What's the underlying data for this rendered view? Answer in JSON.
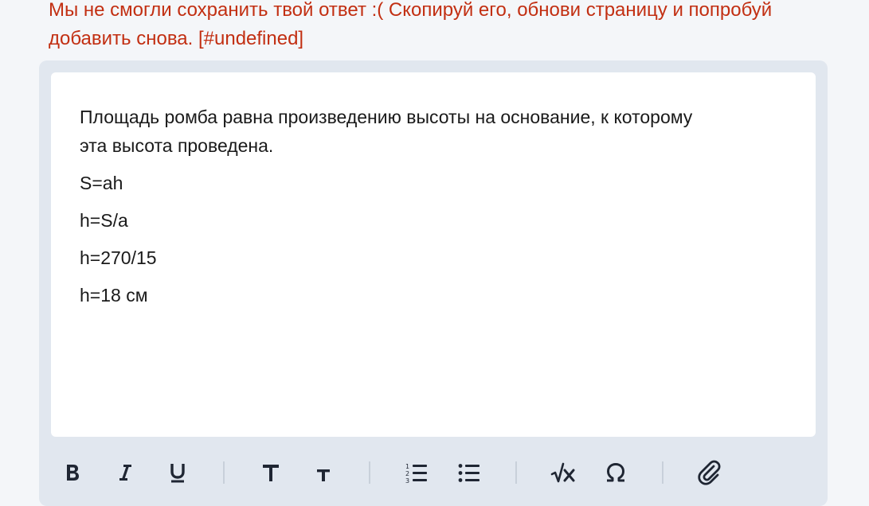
{
  "error": {
    "message": "Мы не смогли сохранить твой ответ :( Скопируй его, обнови страницу и попробуй добавить снова. [#undefined]"
  },
  "editor": {
    "paragraphs": [
      "Площадь ромба равна произведению высоты на основание, к которому эта высота проведена.",
      "S=ah",
      "h=S/a",
      "h=270/15",
      "h=18 см"
    ]
  },
  "toolbar": {
    "tools": [
      {
        "name": "bold",
        "icon": "bold-icon"
      },
      {
        "name": "italic",
        "icon": "italic-icon"
      },
      {
        "name": "underline",
        "icon": "underline-icon"
      },
      {
        "name": "heading-large",
        "icon": "heading-large-icon"
      },
      {
        "name": "heading-small",
        "icon": "heading-small-icon"
      },
      {
        "name": "ordered-list",
        "icon": "ordered-list-icon"
      },
      {
        "name": "bullet-list",
        "icon": "bullet-list-icon"
      },
      {
        "name": "math-formula",
        "icon": "square-root-icon"
      },
      {
        "name": "special-symbol",
        "icon": "omega-icon"
      },
      {
        "name": "attachment",
        "icon": "paperclip-icon"
      }
    ]
  },
  "colors": {
    "error": "#c22f12",
    "frame": "#e1e7ef",
    "editor_bg": "#ffffff",
    "icon": "#1f2633"
  }
}
